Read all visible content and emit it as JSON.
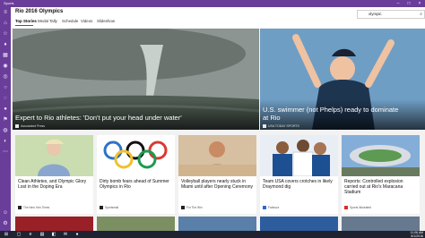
{
  "window": {
    "title": "Sports"
  },
  "header": {
    "section_title": "Rio 2016 Olympics",
    "tabs": [
      {
        "label": "Top Stories"
      },
      {
        "label": "Medal Tally"
      },
      {
        "label": "Schedule"
      },
      {
        "label": "Videos"
      },
      {
        "label": "Slideshow"
      }
    ]
  },
  "search": {
    "value": "olympic"
  },
  "heroes": [
    {
      "title": "Expert to Rio athletes: 'Don't put your head under water'",
      "source": "Associated Press"
    },
    {
      "title": "U.S. swimmer (not Phelps) ready to dominate at Rio",
      "source": "USA TODAY SPORTS"
    }
  ],
  "cards": [
    {
      "title": "Clean Athletes, and Olympic Glory Lost in the Doping Era",
      "source": "The New York Times"
    },
    {
      "title": "Dirty bomb fears ahead of Summer Olympics in Rio",
      "source": "Sportsmail"
    },
    {
      "title": "Volleyball players nearly stuck in Miami until after Opening Ceremony",
      "source": "For The Win"
    },
    {
      "title": "Team USA covers crotches in likely Draymond dig",
      "source": "Fanbuzz"
    },
    {
      "title": "Reports: Controlled explosion carried out at Rio's Maracana Stadium",
      "source": "Sports Illustrated"
    }
  ],
  "taskbar": {
    "time": "11:06 AM",
    "date": "8/1/2016"
  }
}
